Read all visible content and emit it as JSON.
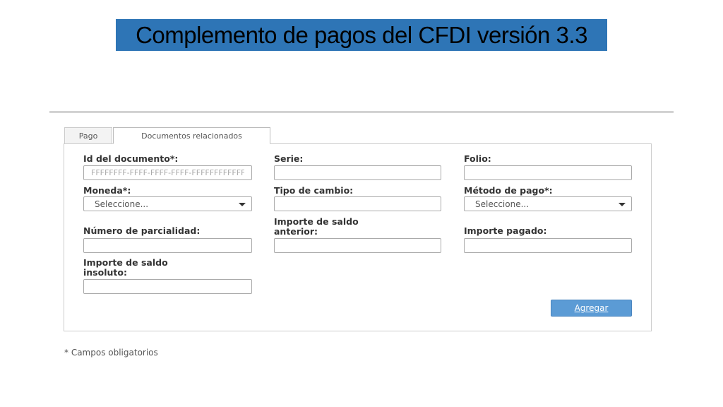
{
  "slide": {
    "title": "Complemento de pagos del CFDI versión 3.3"
  },
  "tabs": [
    {
      "label": "Pago"
    },
    {
      "label": "Documentos relacionados"
    }
  ],
  "form": {
    "id_documento": {
      "label": "Id del documento*:",
      "placeholder": "FFFFFFFF-FFFF-FFFF-FFFF-FFFFFFFFFFFF"
    },
    "serie": {
      "label": "Serie:",
      "value": ""
    },
    "folio": {
      "label": "Folio:",
      "value": ""
    },
    "moneda": {
      "label": "Moneda*:",
      "selected": "Seleccione..."
    },
    "tipo_cambio": {
      "label": "Tipo de cambio:",
      "value": ""
    },
    "metodo_pago": {
      "label": "Método de pago*:",
      "selected": "Seleccione..."
    },
    "num_parcialidad": {
      "label": "Número de parcialidad:",
      "value": ""
    },
    "saldo_anterior": {
      "label_line1": "Importe de saldo",
      "label_line2": "anterior:",
      "value": ""
    },
    "importe_pagado": {
      "label": "Importe pagado:",
      "value": ""
    },
    "saldo_insoluto": {
      "label_line1": "Importe de saldo",
      "label_line2": "insoluto:",
      "value": ""
    },
    "submit_label": "Agregar"
  },
  "footnote": "* Campos obligatorios",
  "colors": {
    "banner": "#2e75b6",
    "button": "#5b9bd5"
  }
}
